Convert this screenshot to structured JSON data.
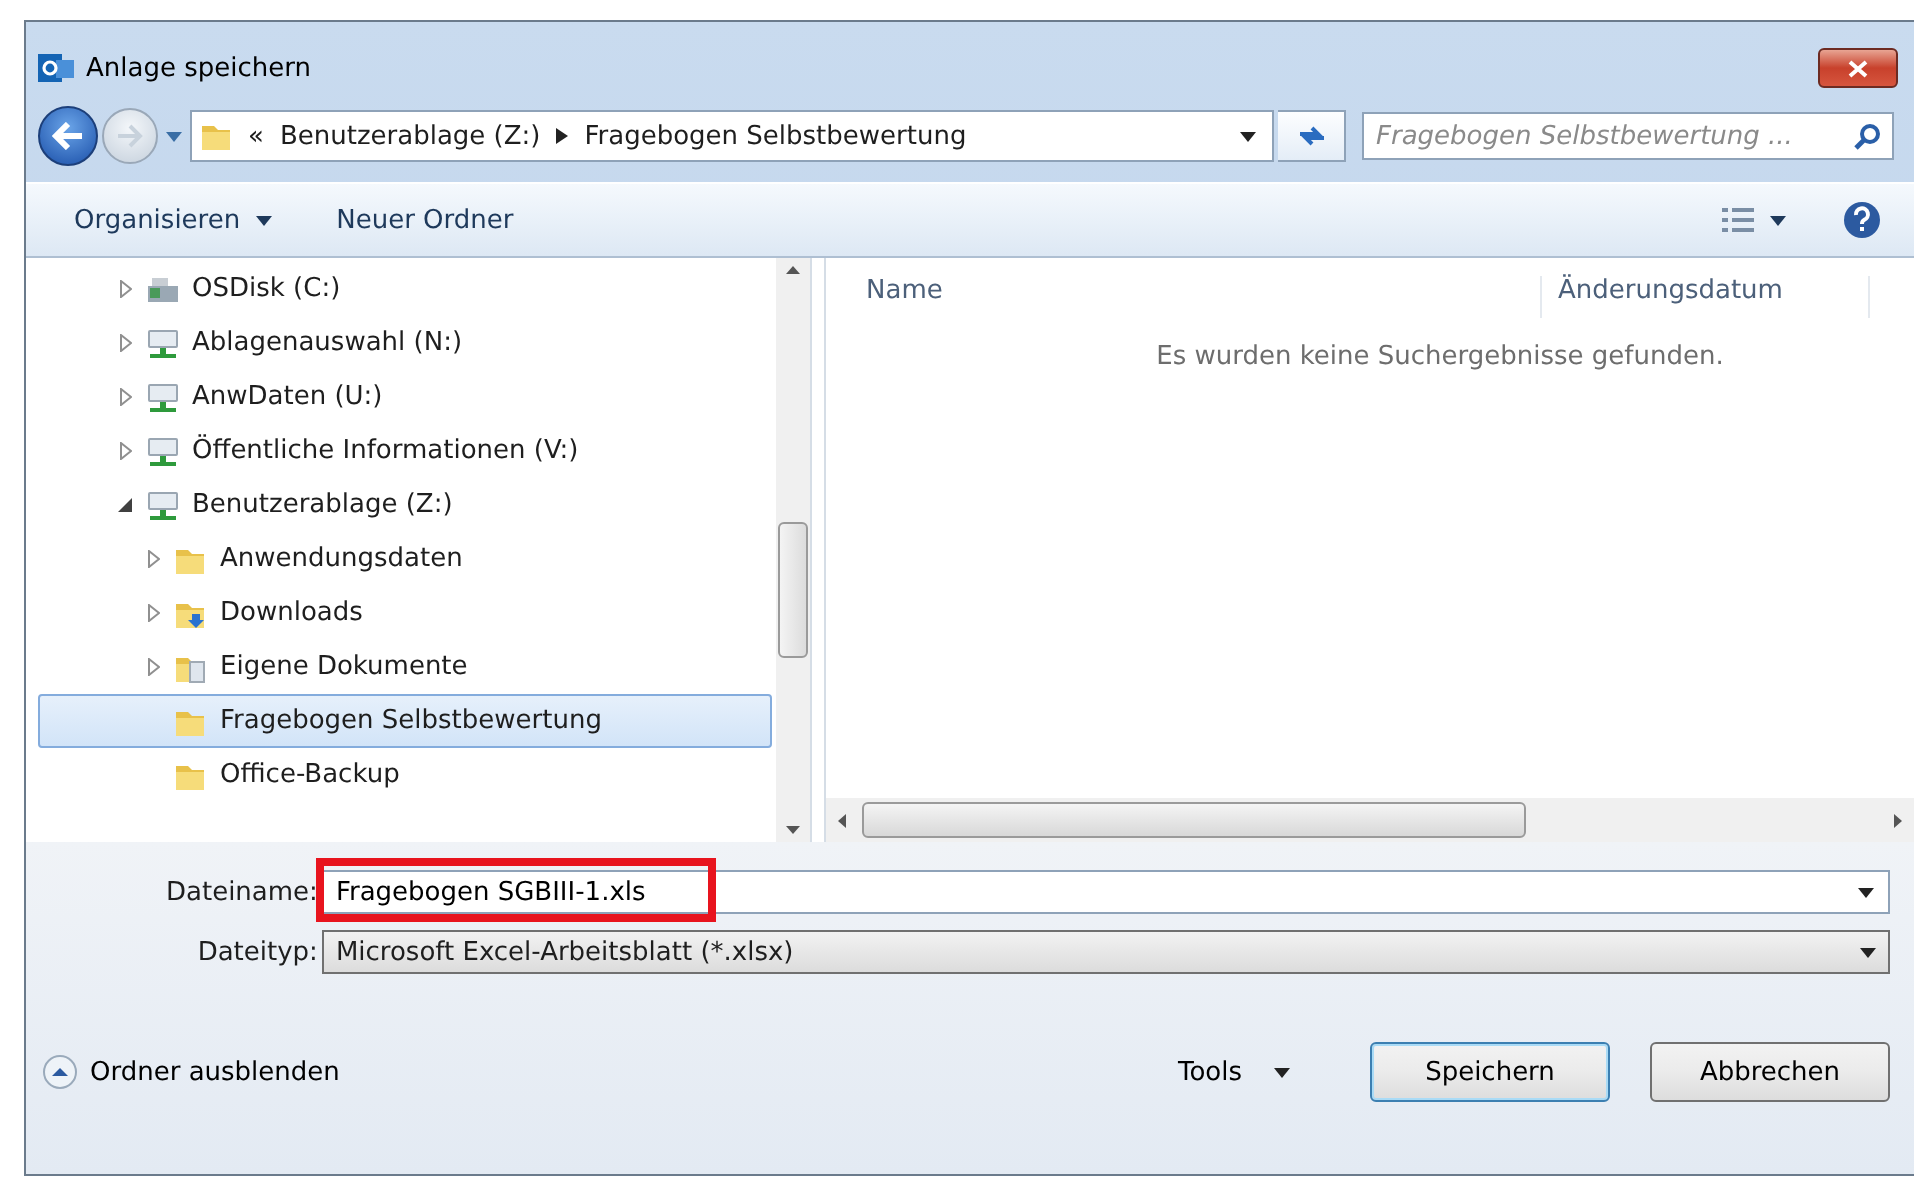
{
  "window": {
    "title": "Anlage speichern"
  },
  "address": {
    "overflow": "«",
    "crumbs": [
      "Benutzerablage (Z:)",
      "Fragebogen Selbstbewertung"
    ]
  },
  "search": {
    "placeholder": "Fragebogen Selbstbewertung ..."
  },
  "toolbar": {
    "items": [
      {
        "label": "Organisieren",
        "dropdown": true
      },
      {
        "label": "Neuer Ordner",
        "dropdown": false
      }
    ]
  },
  "tree": [
    {
      "label": "OSDisk (C:)",
      "kind": "disk",
      "expandable": true,
      "expanded": false,
      "selected": false
    },
    {
      "label": "Ablagenauswahl (N:)",
      "kind": "network",
      "expandable": true,
      "expanded": false,
      "selected": false
    },
    {
      "label": "AnwDaten (U:)",
      "kind": "network",
      "expandable": true,
      "expanded": false,
      "selected": false
    },
    {
      "label": "Öffentliche Informationen (V:)",
      "kind": "network",
      "expandable": true,
      "expanded": false,
      "selected": false
    },
    {
      "label": "Benutzerablage (Z:)",
      "kind": "network",
      "expandable": true,
      "expanded": true,
      "selected": false,
      "children": [
        {
          "label": "Anwendungsdaten",
          "kind": "folder",
          "expandable": true,
          "expanded": false,
          "selected": false
        },
        {
          "label": "Downloads",
          "kind": "downloads",
          "expandable": true,
          "expanded": false,
          "selected": false
        },
        {
          "label": "Eigene Dokumente",
          "kind": "documents",
          "expandable": true,
          "expanded": false,
          "selected": false
        },
        {
          "label": "Fragebogen Selbstbewertung",
          "kind": "folder",
          "expandable": false,
          "selected": true
        },
        {
          "label": "Office-Backup",
          "kind": "folder",
          "expandable": false,
          "selected": false
        }
      ]
    }
  ],
  "file_list": {
    "columns": [
      "Name",
      "Änderungsdatum"
    ],
    "empty_message": "Es wurden keine Suchergebnisse gefunden."
  },
  "file_name": {
    "label": "Dateiname:",
    "value": "Fragebogen SGBIII-1.xls",
    "highlighted": true
  },
  "file_type": {
    "label": "Dateityp:",
    "value": "Microsoft Excel-Arbeitsblatt (*.xlsx)"
  },
  "hide_folders": {
    "label": "Ordner ausblenden"
  },
  "tools": {
    "label": "Tools"
  },
  "buttons": [
    {
      "label": "Speichern",
      "default": true
    },
    {
      "label": "Abbrechen",
      "default": false
    }
  ]
}
